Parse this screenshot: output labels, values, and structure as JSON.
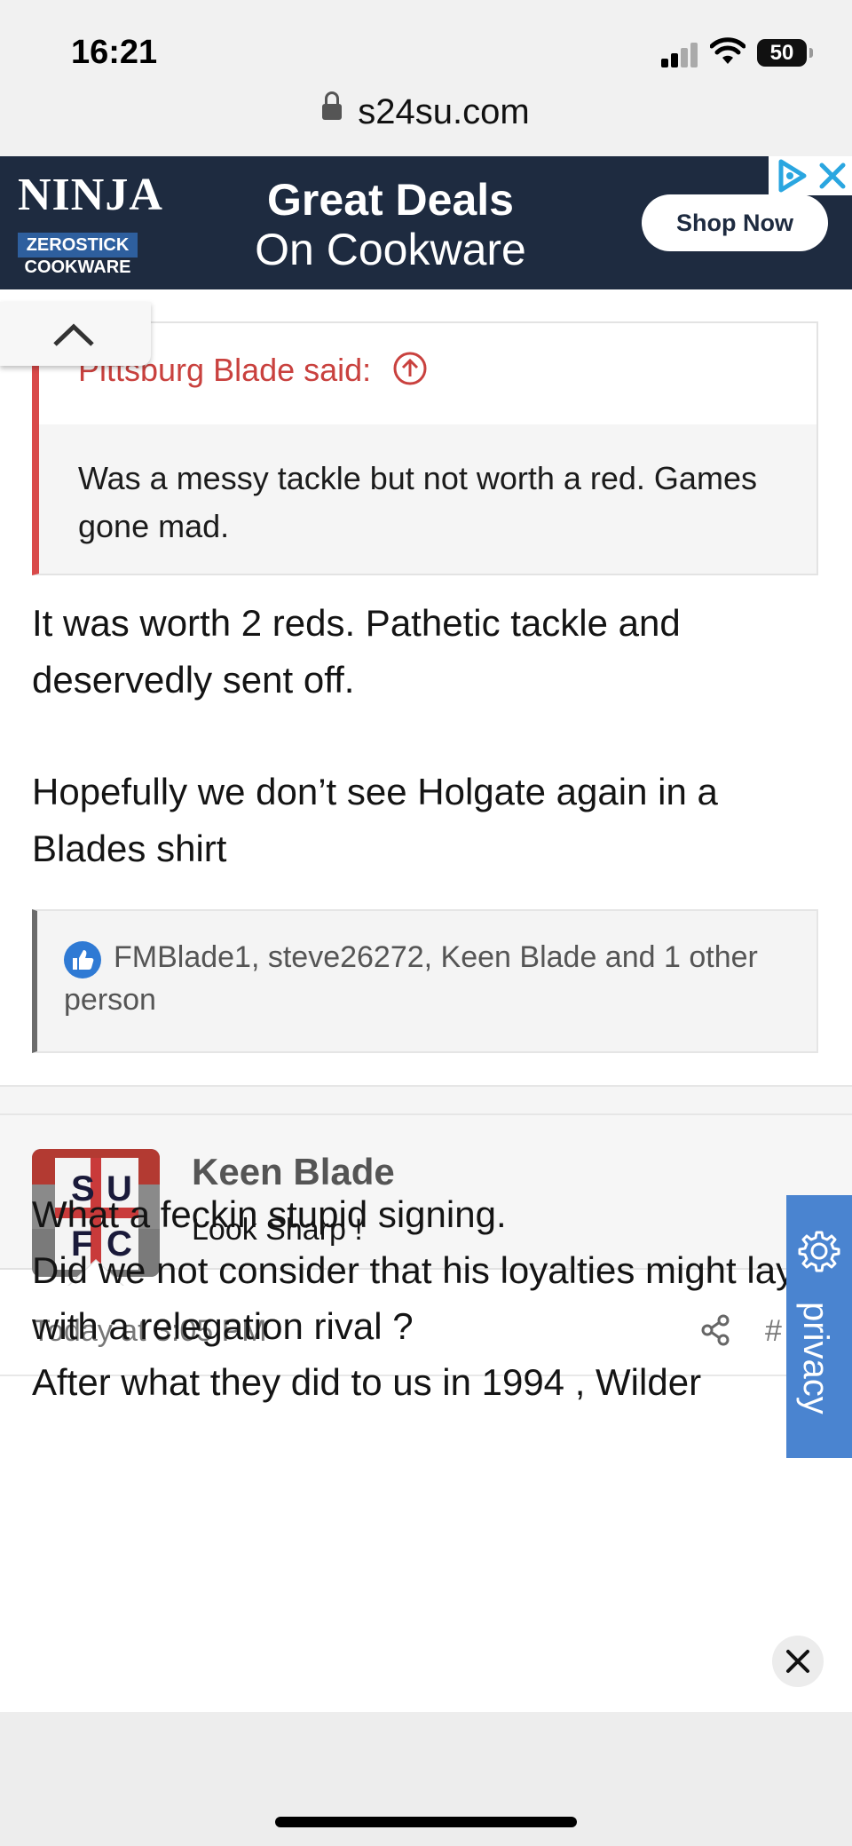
{
  "status": {
    "time": "16:21",
    "battery": "50"
  },
  "browser": {
    "url": "s24su.com"
  },
  "ad": {
    "brand": "NINJA",
    "sub1": "ZEROSTICK",
    "sub2": "COOKWARE",
    "line1": "Great Deals",
    "line2": "On Cookware",
    "cta": "Shop Now"
  },
  "quote": {
    "author": "Pittsburg Blade said:",
    "body": "Was a messy tackle but not worth a red. Games gone mad."
  },
  "post1": {
    "para1": "It was worth 2 reds. Pathetic tackle and deservedly sent off.",
    "para2": "Hopefully we don’t see Holgate again in a Blades shirt",
    "likes": "FMBlade1, steve26272, Keen Blade and 1 other person"
  },
  "post2": {
    "username": "Keen Blade",
    "user_title": "Look Sharp !",
    "date": "Today at 3:05 PM",
    "number": "#",
    "line1": "What a feckin stupid signing.",
    "line2": "Did we not consider that his loyalties might lay with a relegation rival ?",
    "line3": "After what they did to us in 1994 , Wilder"
  },
  "privacy": {
    "label": "privacy"
  },
  "colors": {
    "accent": "#c9413e",
    "privacy": "#4a84d0",
    "ad_bg": "#1e2b40"
  }
}
